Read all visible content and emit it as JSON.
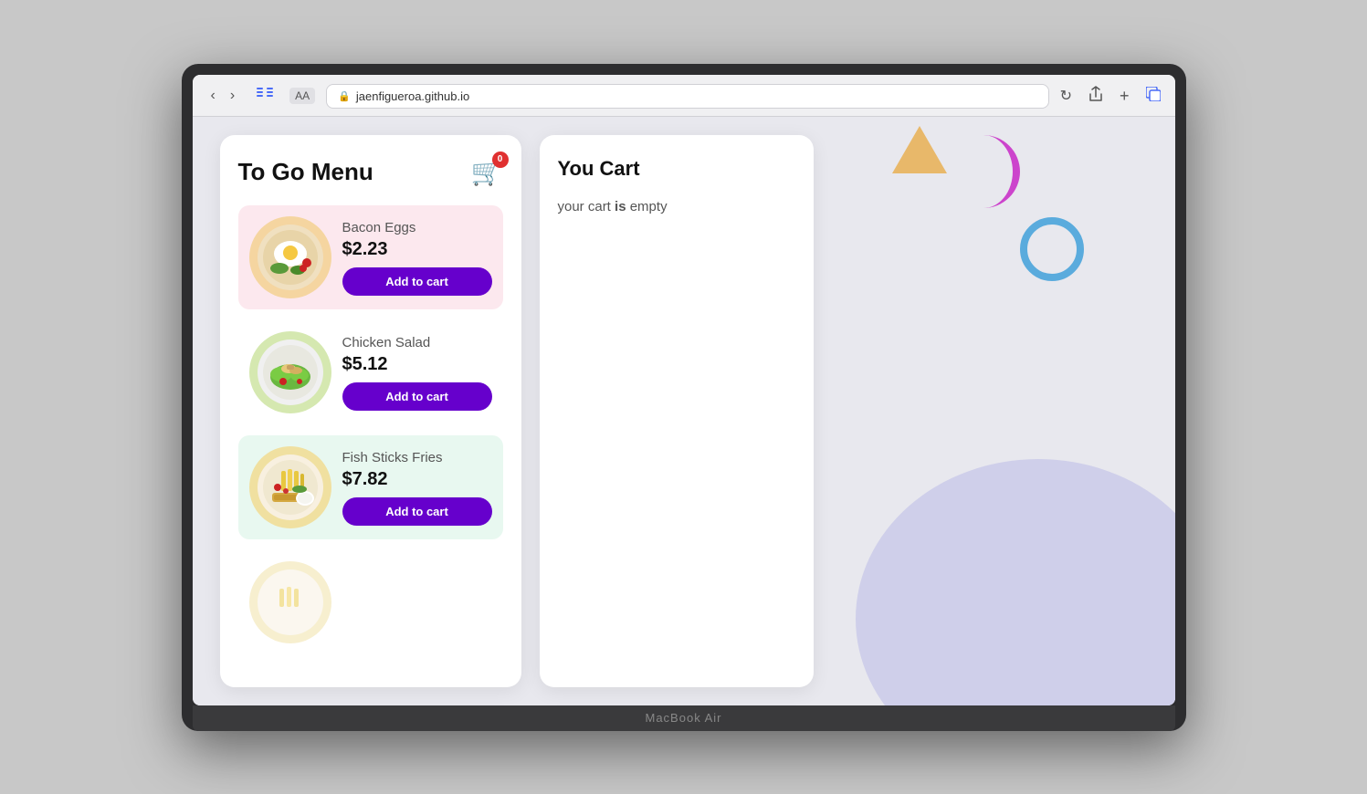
{
  "browser": {
    "url": "jaenfigueroa.github.io",
    "aa_label": "AA",
    "macbook_label": "MacBook Air"
  },
  "menu": {
    "title": "To Go Menu",
    "cart_badge": "0",
    "items": [
      {
        "id": "bacon-eggs",
        "name": "Bacon Eggs",
        "price": "$2.23",
        "bg_class": "pink-bg",
        "emoji": "🍳",
        "button_label": "Add to cart"
      },
      {
        "id": "chicken-salad",
        "name": "Chicken Salad",
        "price": "$5.12",
        "bg_class": "white-bg",
        "emoji": "🥗",
        "button_label": "Add to cart"
      },
      {
        "id": "fish-sticks-fries",
        "name": "Fish Sticks Fries",
        "price": "$7.82",
        "bg_class": "green-bg",
        "emoji": "🍟",
        "button_label": "Add to cart"
      }
    ]
  },
  "cart": {
    "title": "You Cart",
    "empty_text_1": "your cart",
    "empty_text_bold": "is",
    "empty_text_2": "empty"
  }
}
